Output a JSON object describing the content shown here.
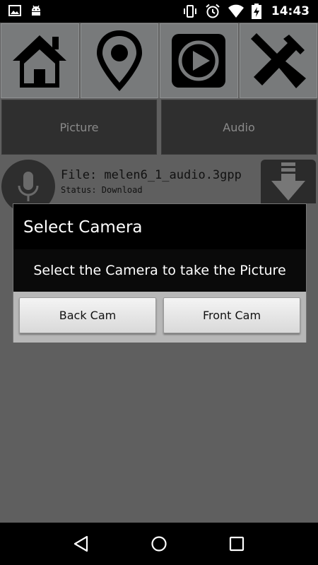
{
  "status_bar": {
    "time": "14:43",
    "left_icons": [
      "image-icon",
      "android-icon"
    ],
    "right_icons": [
      "vibrate-icon",
      "alarm-icon",
      "wifi-icon",
      "battery-charging-icon"
    ]
  },
  "toolbar": {
    "items": [
      {
        "icon": "home-icon"
      },
      {
        "icon": "location-pin-icon"
      },
      {
        "icon": "play-icon"
      },
      {
        "icon": "tools-icon"
      }
    ]
  },
  "tabs": {
    "picture": "Picture",
    "audio": "Audio"
  },
  "file": {
    "name": "File: melen6_1_audio.3gpp",
    "status": "Status: Download"
  },
  "dialog": {
    "title": "Select Camera",
    "message": "Select the Camera to take the Picture",
    "back_button": "Back Cam",
    "front_button": "Front Cam"
  },
  "colors": {
    "background": "#5f5f5f",
    "tool_bg": "#787a7b",
    "tab_bg": "#2f2f2f",
    "dialog_bg": "#000000",
    "dialog_footer": "#b7b7b7"
  },
  "nav_bar": {
    "icons": [
      "back-icon",
      "home-circle-icon",
      "recents-icon"
    ]
  }
}
